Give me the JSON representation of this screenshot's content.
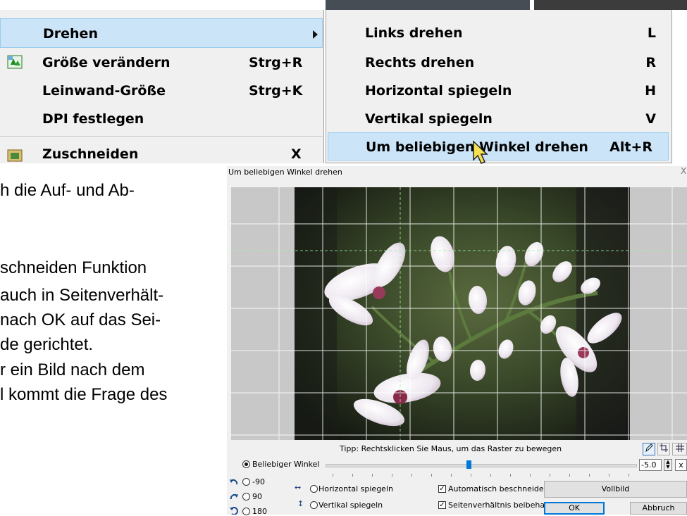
{
  "menu_main": {
    "items": [
      {
        "label": "Drehen",
        "shortcut": ""
      },
      {
        "label": "Größe verändern",
        "shortcut": "Strg+R"
      },
      {
        "label": "Leinwand-Größe",
        "shortcut": "Strg+K"
      },
      {
        "label": "DPI festlegen",
        "shortcut": ""
      },
      {
        "label": "Zuschneiden",
        "shortcut": "X"
      }
    ]
  },
  "menu_rotate": {
    "items": [
      {
        "label": "Links drehen",
        "shortcut": "L"
      },
      {
        "label": "Rechts drehen",
        "shortcut": "R"
      },
      {
        "label": "Horizontal spiegeln",
        "shortcut": "H"
      },
      {
        "label": "Vertikal spiegeln",
        "shortcut": "V"
      },
      {
        "label": "Um beliebigen Winkel drehen",
        "shortcut": "Alt+R"
      }
    ]
  },
  "document": {
    "lines": [
      "h die Auf- und Ab-",
      "schneiden Funktion",
      "auch in Seitenverhält-",
      "nach OK auf das Sei-",
      "de gerichtet.",
      "r ein Bild nach dem",
      "l kommt die Frage des"
    ]
  },
  "dialog": {
    "title": "Um beliebigen Winkel drehen",
    "close": "X",
    "tip": "Tipp: Rechtsklicken Sie Maus, um das Raster zu bewegen",
    "any_angle_label": "Beliebiger Winkel",
    "angle_value": "-5.0",
    "x_button": "x",
    "slider_level": 0.46,
    "rot_minus90": "-90",
    "rot_90": "90",
    "rot_180": "180",
    "flip_h": "Horizontal spiegeln",
    "flip_v": "Vertikal spiegeln",
    "auto_crop": "Automatisch beschneiden",
    "keep_ratio": "Seitenverhältnis beibehalten",
    "fullscreen_button": "Vollbild",
    "ok_button": "OK",
    "cancel_button": "Abbruch"
  }
}
